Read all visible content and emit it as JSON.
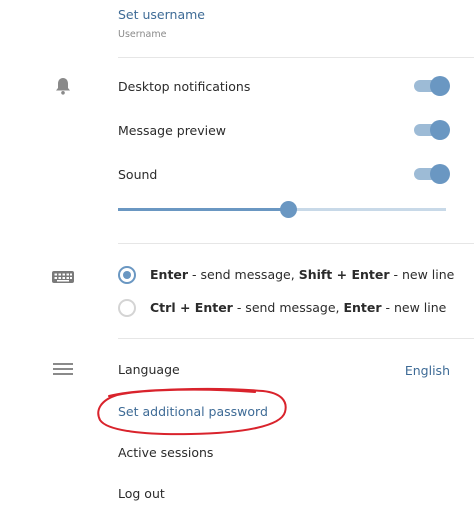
{
  "username": {
    "link": "Set username",
    "hint": "Username"
  },
  "notifications": {
    "desktop_label": "Desktop notifications",
    "preview_label": "Message preview",
    "sound_label": "Sound",
    "desktop_on": true,
    "preview_on": true,
    "sound_on": true,
    "volume": 0.52
  },
  "send_options": {
    "option1": {
      "k1": "Enter",
      "t1": " - send message, ",
      "k2": "Shift + Enter",
      "t2": " - new line",
      "selected": true
    },
    "option2": {
      "k1": "Ctrl + Enter",
      "t1": " - send message, ",
      "k2": "Enter",
      "t2": " - new line",
      "selected": false
    }
  },
  "general": {
    "language_label": "Language",
    "language_value": "English",
    "additional_password": "Set additional password",
    "active_sessions": "Active sessions",
    "log_out": "Log out"
  },
  "colors": {
    "accent": "#6a97c2",
    "link": "#3e6b96",
    "annotation": "#d9232c"
  },
  "icons": [
    "bell-icon",
    "keyboard-icon",
    "menu-icon"
  ]
}
